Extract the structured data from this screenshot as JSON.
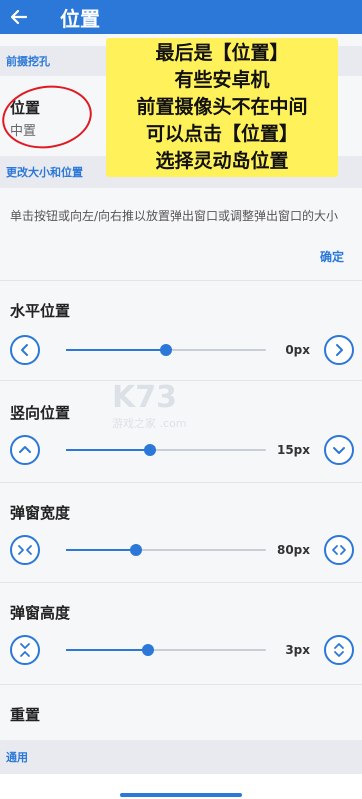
{
  "appbar": {
    "title": "位置"
  },
  "sections": {
    "notch": "前摄挖孔",
    "resize": "更改大小和位置",
    "general": "通用"
  },
  "position_pref": {
    "title": "位置",
    "summary": "中置"
  },
  "description": "单击按钮或向左/向右推以放置弹出窗口或调整弹出窗口的大小",
  "confirm_label": "确定",
  "sliders": [
    {
      "label": "水平位置",
      "value": "0px",
      "level": 0.5
    },
    {
      "label": "竖向位置",
      "value": "15px",
      "level": 0.42
    },
    {
      "label": "弹窗宽度",
      "value": "80px",
      "level": 0.35
    },
    {
      "label": "弹窗高度",
      "value": "3px",
      "level": 0.41
    }
  ],
  "reset_label": "重置",
  "overlay_text": [
    "最后是【位置】",
    "有些安卓机",
    "前置摄像头不在中间",
    "可以点击【位置】",
    "选择灵动岛位置"
  ],
  "watermark": {
    "logo": "K73",
    "sub": "游戏之家 .com"
  },
  "colors": {
    "accent": "#2b78d8",
    "annotation": "#e01a22",
    "highlight": "#fff15a"
  }
}
